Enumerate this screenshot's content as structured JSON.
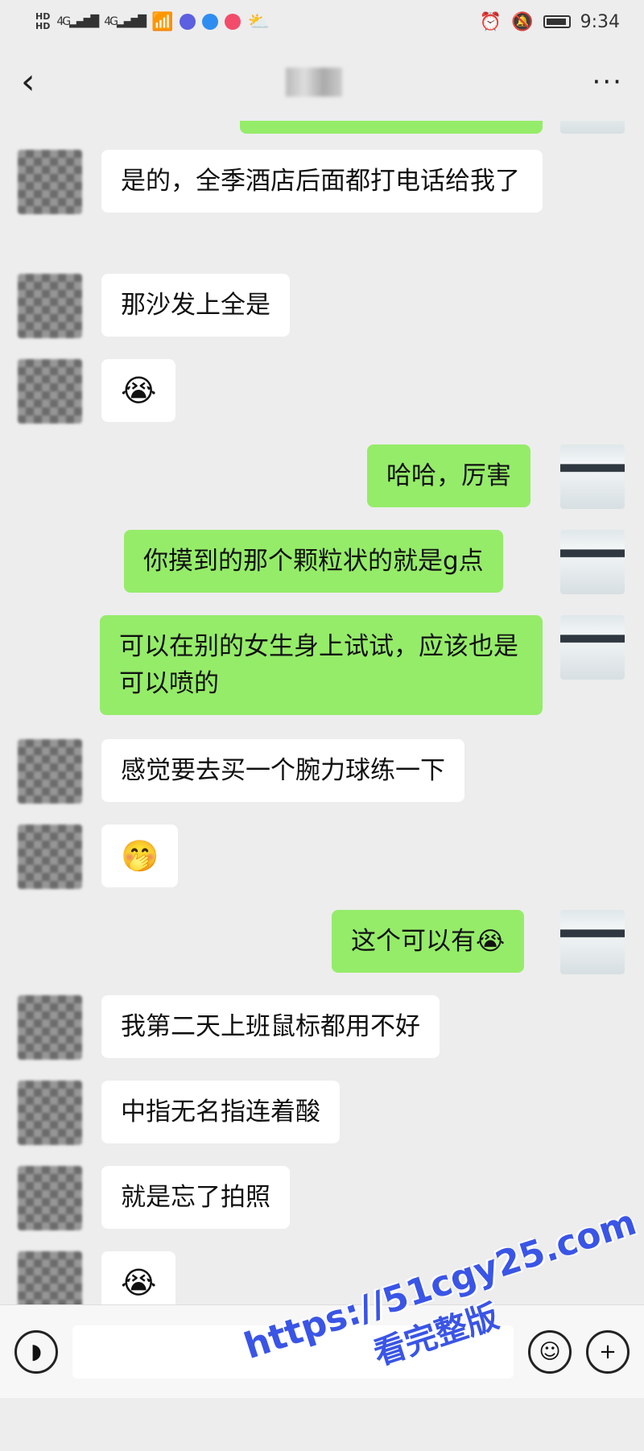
{
  "status": {
    "time": "9:34",
    "hd1": "HD",
    "hd2": "HD",
    "signal1": "4G",
    "signal2": "4G"
  },
  "header": {
    "back_icon": "chevron-left-icon",
    "more_label": "···"
  },
  "messages": [
    {
      "side": "left",
      "text": "是的，全季酒店后面都打电话给我了"
    },
    {
      "side": "left",
      "text": "那沙发上全是"
    },
    {
      "side": "left",
      "text": "😭"
    },
    {
      "side": "right",
      "text": "哈哈，厉害"
    },
    {
      "side": "right",
      "text": "你摸到的那个颗粒状的就是g点"
    },
    {
      "side": "right",
      "text": "可以在别的女生身上试试，应该也是可以喷的"
    },
    {
      "side": "left",
      "text": "感觉要去买一个腕力球练一下"
    },
    {
      "side": "left",
      "text": "🤭"
    },
    {
      "side": "right",
      "text": "这个可以有😭"
    },
    {
      "side": "left",
      "text": "我第二天上班鼠标都用不好"
    },
    {
      "side": "left",
      "text": "中指无名指连着酸"
    },
    {
      "side": "left",
      "text": "就是忘了拍照"
    },
    {
      "side": "left",
      "text": "😭"
    }
  ],
  "inputbar": {
    "voice_icon": "voice-icon",
    "emoji_icon": "emoji-icon",
    "plus_icon": "plus-icon"
  },
  "watermark": {
    "url": "https://51cgy25.com",
    "subtitle": "看完整版"
  },
  "colors": {
    "background": "#ededed",
    "bubble_right": "#95ec69",
    "bubble_left": "#ffffff",
    "watermark": "#3a55e6"
  }
}
